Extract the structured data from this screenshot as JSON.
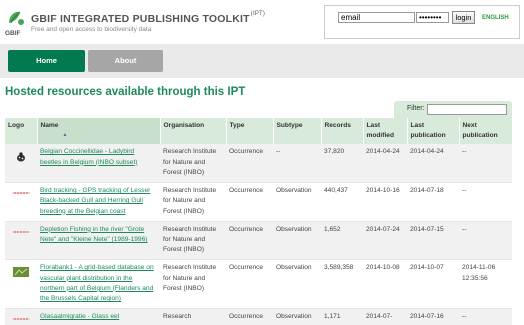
{
  "header": {
    "title": "GBIF INTEGRATED PUBLISHING TOOLKIT",
    "title_sup": "(IPT)",
    "subtitle": "Free and open access to biodiversity data",
    "logo_text": "GBIF"
  },
  "login": {
    "email_value": "email",
    "password_value": "••••••••",
    "button_label": "login",
    "language": "ENGLISH"
  },
  "nav": {
    "home": "Home",
    "about": "About"
  },
  "page_title": "Hosted resources available through this IPT",
  "filter": {
    "label": "Filter:",
    "value": ""
  },
  "table": {
    "headers": {
      "logo": "Logo",
      "name": "Name",
      "organisation": "Organisation",
      "type": "Type",
      "subtype": "Subtype",
      "records": "Records",
      "last_modified": "Last modified",
      "last_publication": "Last publication",
      "next_publication": "Next publication"
    },
    "rows": [
      {
        "logo": "ladybird",
        "name": "Belgian Coccinellidae - Ladybird beetles in Belgium (INBO subset)",
        "organisation": "Research Institute for Nature and Forest (INBO)",
        "type": "Occurrence",
        "subtype": "--",
        "records": "37,820",
        "last_modified": "2014-04-24",
        "last_publication": "2014-04-24",
        "next_publication": "--"
      },
      {
        "logo": "bird",
        "name": "Bird tracking - GPS tracking of Lesser Black-backed Gull and Herring Gull breeding at the Belgian coast",
        "organisation": "Research Institute for Nature and Forest (INBO)",
        "type": "Occurrence",
        "subtype": "Observation",
        "records": "440,437",
        "last_modified": "2014-10-16",
        "last_publication": "2014-07-18",
        "next_publication": "--"
      },
      {
        "logo": "fish",
        "name": "Depletion Fishing in the river \"Grote Nete\" and \"Kleine Nete\" (1989-1996)",
        "organisation": "Research Institute for Nature and Forest (INBO)",
        "type": "Occurrence",
        "subtype": "Observation",
        "records": "1,652",
        "last_modified": "2014-07-24",
        "last_publication": "2014-07-15",
        "next_publication": "--"
      },
      {
        "logo": "plant",
        "name": "Florabank1 - A grid-based database on vascular plant distribution in the northern part of Belgium (Flanders and the Brussels Capital region)",
        "organisation": "Research Institute for Nature and Forest (INBO)",
        "type": "Occurrence",
        "subtype": "Observation",
        "records": "3,589,358",
        "last_modified": "2014-10-08",
        "last_publication": "2014-10-07",
        "next_publication": "2014-11-06 12:35:56"
      },
      {
        "logo": "eel",
        "name": "Glasaalmigratie - Glass eel",
        "organisation": "Research",
        "type": "Occurrence",
        "subtype": "Observation",
        "records": "1,171",
        "last_modified": "2014-07-",
        "last_publication": "2014-07-16",
        "next_publication": "--"
      }
    ]
  },
  "colors": {
    "accent": "#1d8a5b",
    "nav_active": "#007a4e",
    "header_bg": "#d8ead9"
  }
}
